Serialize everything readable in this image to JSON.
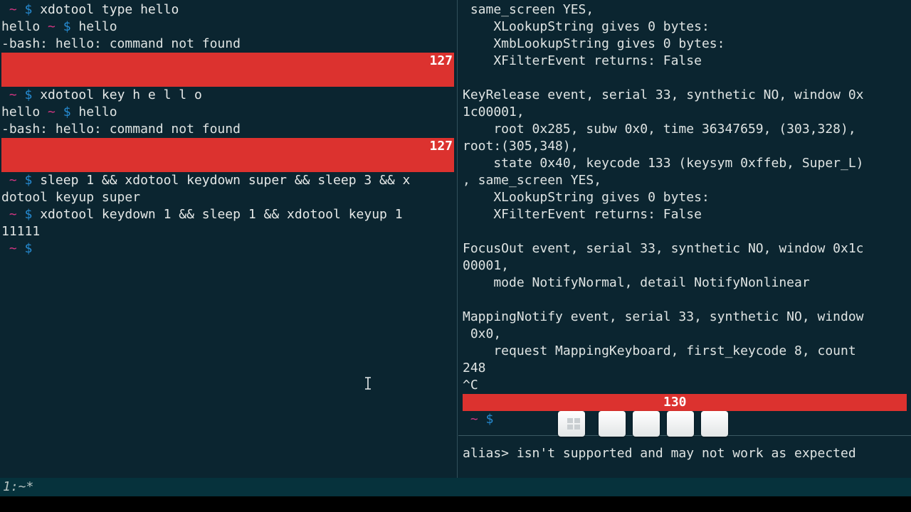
{
  "left_pane": {
    "prompt": {
      "tilde": "~",
      "dollar": "$"
    },
    "commands": {
      "cmd1": "xdotool type hello",
      "out1_text": "hello",
      "out1_cmd": "hello",
      "err1": "-bash: hello: command not found",
      "exit1": "127",
      "cmd2": "xdotool key h e l l o",
      "out2_text": "hello",
      "out2_cmd": "hello",
      "err2": "-bash: hello: command not found",
      "exit2": "127",
      "cmd3_line1": "sleep 1 && xdotool keydown super && sleep 3 && x",
      "cmd3_line2": "dotool keyup super",
      "cmd4": "xdotool keydown 1 && sleep 1 && xdotool keyup 1",
      "out4": "11111"
    }
  },
  "right_pane": {
    "lines": [
      " same_screen YES,",
      "    XLookupString gives 0 bytes:",
      "    XmbLookupString gives 0 bytes:",
      "    XFilterEvent returns: False",
      "",
      "KeyRelease event, serial 33, synthetic NO, window 0x",
      "1c00001,",
      "    root 0x285, subw 0x0, time 36347659, (303,328),",
      "root:(305,348),",
      "    state 0x40, keycode 133 (keysym 0xffeb, Super_L)",
      ", same_screen YES,",
      "    XLookupString gives 0 bytes:",
      "    XFilterEvent returns: False",
      "",
      "FocusOut event, serial 33, synthetic NO, window 0x1c",
      "00001,",
      "    mode NotifyNormal, detail NotifyNonlinear",
      "",
      "MappingNotify event, serial 33, synthetic NO, window",
      " 0x0,",
      "    request MappingKeyboard, first_keycode 8, count",
      "248",
      "^C"
    ],
    "exit_code": "130",
    "prompt": {
      "tilde": "~",
      "dollar": "$"
    },
    "bottom_message": "alias> isn't supported and may not work as expected"
  },
  "status_bar": {
    "window_list": "1:~*"
  },
  "key_overlay": {
    "keys": [
      "windows-key",
      "blank-key",
      "blank-key",
      "blank-key",
      "blank-key"
    ]
  },
  "colors": {
    "background": "#0b2530",
    "error_bar": "#dc322f",
    "prompt_tilde": "#d33682",
    "prompt_dollar": "#268bd2",
    "status_bar": "#06323c"
  }
}
